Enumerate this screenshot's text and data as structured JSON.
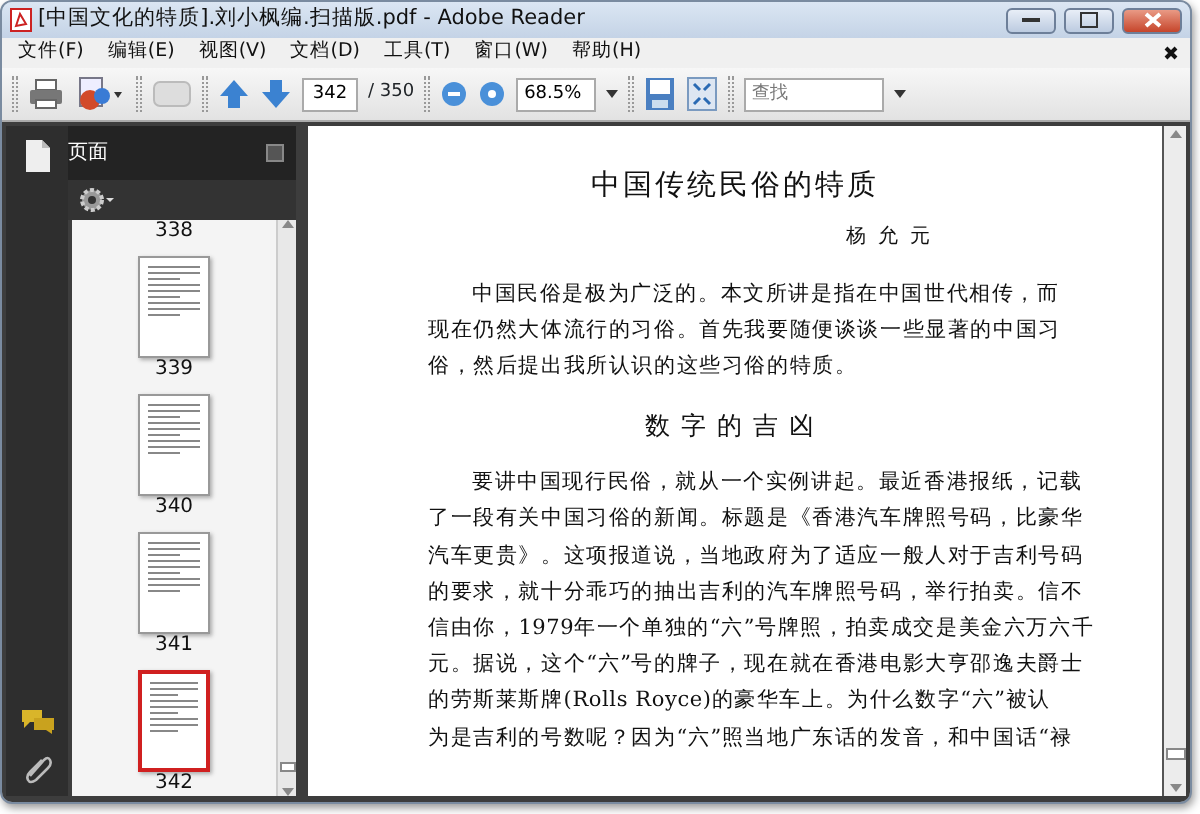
{
  "window": {
    "title": "[中国文化的特质].刘小枫编.扫描版.pdf - Adobe Reader"
  },
  "menu": [
    {
      "label": "文件(F)"
    },
    {
      "label": "编辑(E)"
    },
    {
      "label": "视图(V)"
    },
    {
      "label": "文档(D)"
    },
    {
      "label": "工具(T)"
    },
    {
      "label": "窗口(W)"
    },
    {
      "label": "帮助(H)"
    }
  ],
  "toolbar": {
    "page_number": "342",
    "page_total": "/ 350",
    "zoom": "68.5%",
    "search": {
      "placeholder": "查找"
    }
  },
  "sidebar": {
    "title": "页面",
    "thumbnails": [
      {
        "label": "338",
        "kind": "label"
      },
      {
        "label": "339",
        "kind": "page",
        "selected": false
      },
      {
        "label": "340",
        "kind": "page",
        "selected": false
      },
      {
        "label": "341",
        "kind": "page",
        "selected": false
      },
      {
        "label": "342",
        "kind": "page",
        "selected": true
      }
    ]
  },
  "document": {
    "title": "中国传统民俗的特质",
    "author": "杨允元",
    "blocks": [
      {
        "kind": "paragraph",
        "lines": [
          "中国民俗是极为广泛的。本文所讲是指在中国世代相传，而",
          "现在仍然大体流行的习俗。首先我要随便谈谈一些显著的中国习",
          "俗，然后提出我所认识的这些习俗的特质。"
        ]
      },
      {
        "kind": "heading",
        "text": "数字的吉凶"
      },
      {
        "kind": "paragraph",
        "lines": [
          "要讲中国现行民俗，就从一个实例讲起。最近香港报纸，记载",
          "了一段有关中国习俗的新闻。标题是《香港汽车牌照号码，比豪华",
          "汽车更贵》。这项报道说，当地政府为了适应一般人对于吉利号码",
          "的要求，就十分乖巧的抽出吉利的汽车牌照号码，举行拍卖。信不",
          "信由你，1979年一个单独的“六”号牌照，拍卖成交是美金六万六千",
          "元。据说，这个“六”号的牌子，现在就在香港电影大亨邵逸夫爵士",
          "的劳斯莱斯牌(Rolls Royce)的豪华车上。为什么数字“六”被认",
          "为是吉利的号数呢？因为“六”照当地广东话的发音，和中国话“禄"
        ]
      }
    ]
  }
}
